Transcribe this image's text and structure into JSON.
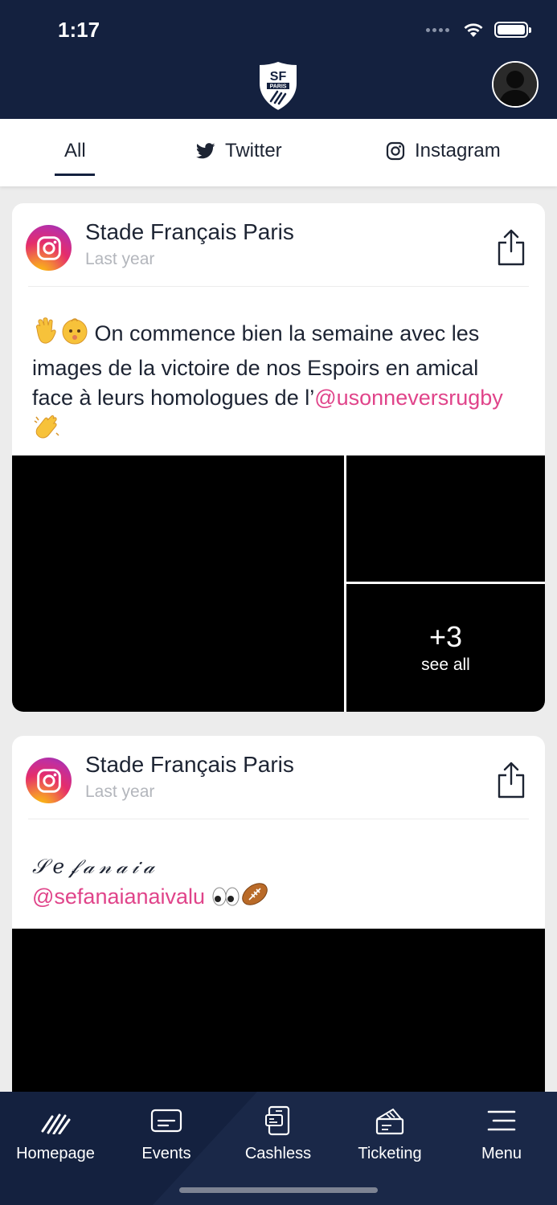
{
  "status_bar": {
    "time": "1:17"
  },
  "header": {
    "logo_text_top": "SF",
    "logo_text_bottom": "PARIS"
  },
  "tabs": [
    {
      "label": "All",
      "active": true
    },
    {
      "label": "Twitter",
      "icon": "twitter-icon"
    },
    {
      "label": "Instagram",
      "icon": "instagram-icon"
    }
  ],
  "posts": [
    {
      "source_icon": "instagram-icon",
      "author": "Stade Français Paris",
      "time": "Last year",
      "text_before": "On commence bien la semaine avec les images de la victoire de nos Espoirs en amical face à leurs homologues de l’",
      "mention": "@usonneversrugby",
      "gallery": {
        "more_count": "+3",
        "see_all": "see all"
      }
    },
    {
      "source_icon": "instagram-icon",
      "author": "Stade Français Paris",
      "time": "Last year",
      "script_name": "𝒮𝑒𝒻𝒶𝓃𝒶𝒾𝒶",
      "mention": "@sefanaianaivalu"
    }
  ],
  "bottom_nav": [
    {
      "label": "Homepage",
      "icon": "homepage-claw-icon"
    },
    {
      "label": "Events",
      "icon": "events-card-icon"
    },
    {
      "label": "Cashless",
      "icon": "cashless-phone-icon"
    },
    {
      "label": "Ticketing",
      "icon": "ticketing-ticket-icon"
    },
    {
      "label": "Menu",
      "icon": "menu-hamburger-icon"
    }
  ],
  "colors": {
    "navy": "#14213f",
    "mention_pink": "#e0448a",
    "muted_gray": "#b3b6bc"
  }
}
